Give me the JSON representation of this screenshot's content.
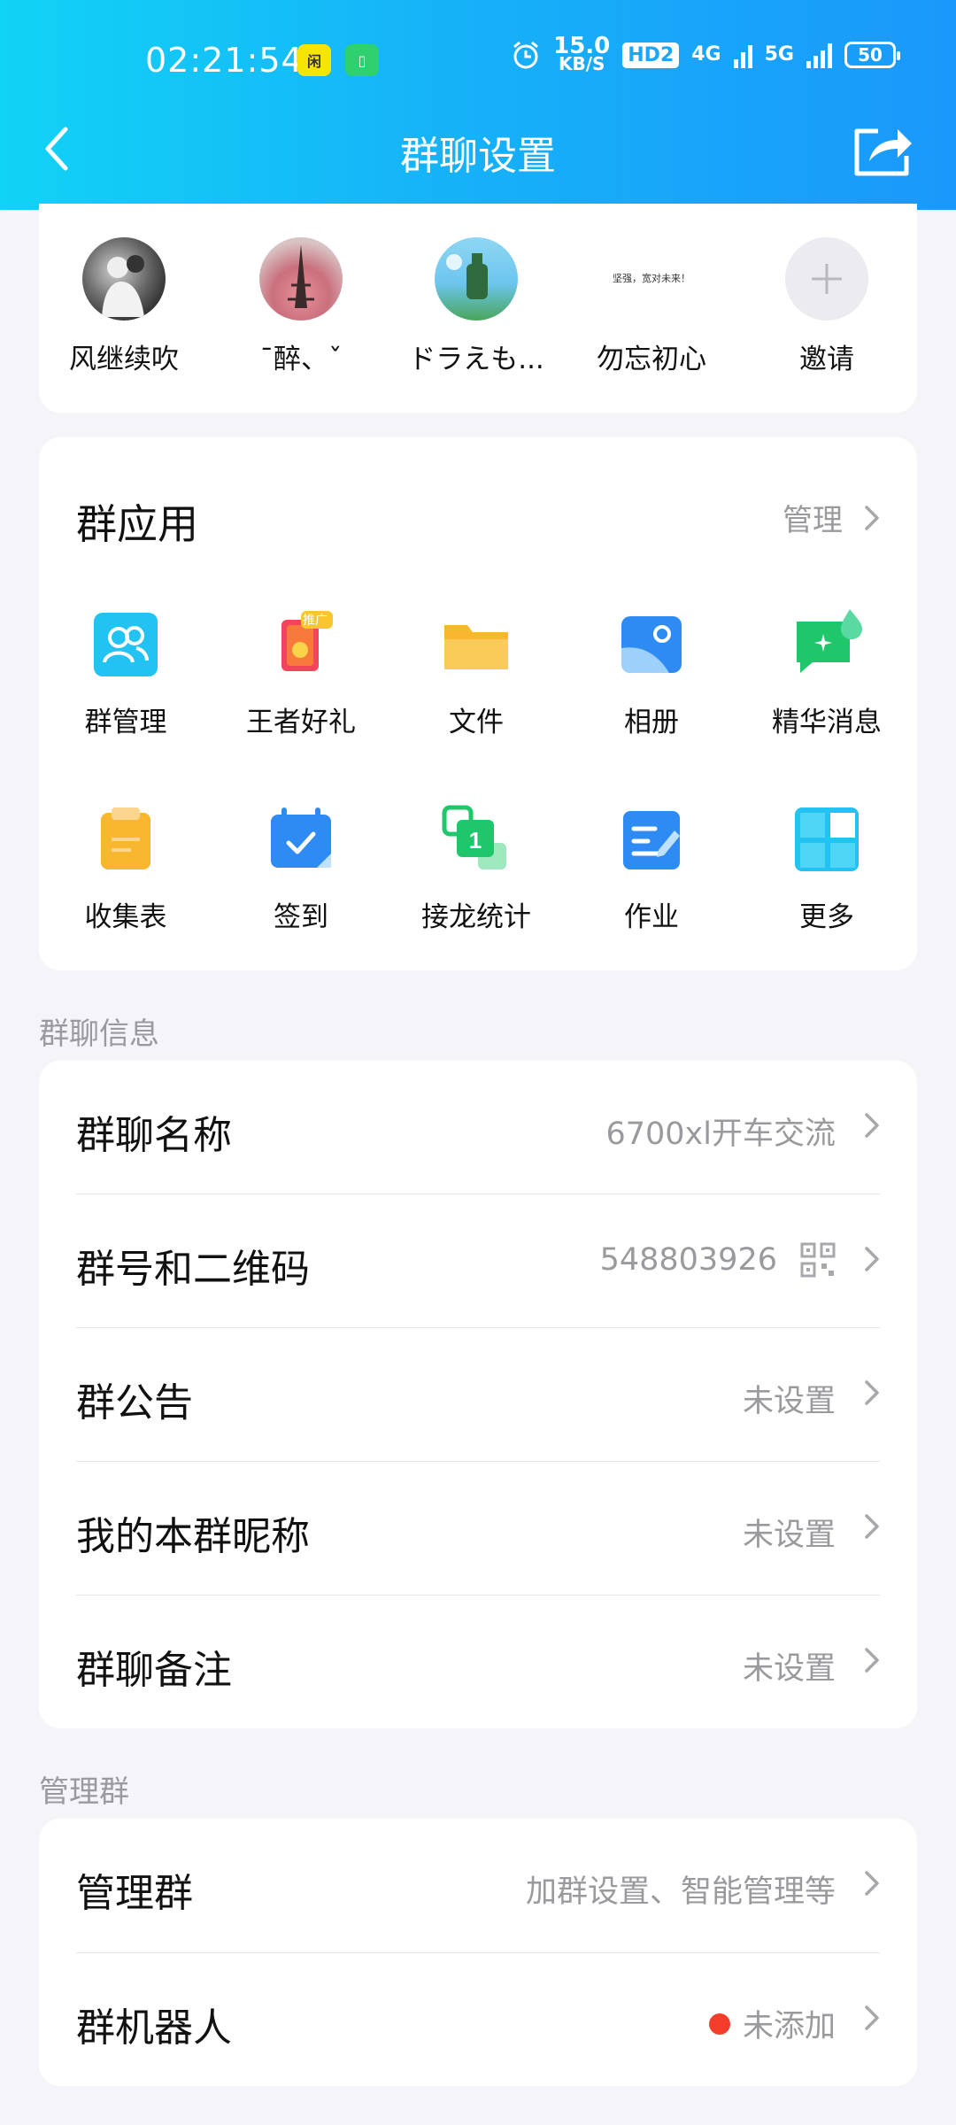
{
  "status_bar": {
    "time": "02:21:54",
    "speed_value": "15.0",
    "speed_unit": "KB/S",
    "hd": "HD2",
    "net_4g": "4G",
    "net_5g": "5G",
    "battery": "50"
  },
  "nav": {
    "title": "群聊设置",
    "back_icon": "back-arrow-icon",
    "share_icon": "share-icon"
  },
  "members": [
    {
      "name": "风继续吹"
    },
    {
      "name": "ˉ醉、ˇ"
    },
    {
      "name": "ドラえも..."
    },
    {
      "name": "勿忘初心",
      "avatar_text": "坚强，宽对未来！"
    },
    {
      "name": "邀请"
    }
  ],
  "group_apps": {
    "title": "群应用",
    "action": "管理",
    "items": [
      {
        "label": "群管理",
        "icon": "group-manage-icon",
        "color": "#22C3F2"
      },
      {
        "label": "王者好礼",
        "icon": "gift-icon",
        "badge": "推广",
        "color": "#F2445A"
      },
      {
        "label": "文件",
        "icon": "folder-icon",
        "color": "#F9B62F"
      },
      {
        "label": "相册",
        "icon": "album-icon",
        "color": "#2E8BF3"
      },
      {
        "label": "精华消息",
        "icon": "essence-message-icon",
        "color": "#1FC76A"
      },
      {
        "label": "收集表",
        "icon": "clipboard-icon",
        "color": "#F9B62F"
      },
      {
        "label": "签到",
        "icon": "calendar-check-icon",
        "color": "#2E8BF3"
      },
      {
        "label": "接龙统计",
        "icon": "relay-count-icon",
        "color": "#1FC76A"
      },
      {
        "label": "作业",
        "icon": "homework-icon",
        "color": "#2E8BF3"
      },
      {
        "label": "更多",
        "icon": "more-grid-icon",
        "color": "#22C3F2"
      }
    ]
  },
  "group_info": {
    "section_label": "群聊信息",
    "rows": [
      {
        "label": "群聊名称",
        "value": "6700xl开车交流"
      },
      {
        "label": "群号和二维码",
        "value": "548803926"
      },
      {
        "label": "群公告",
        "value": "未设置"
      },
      {
        "label": "我的本群昵称",
        "value": "未设置"
      },
      {
        "label": "群聊备注",
        "value": "未设置"
      }
    ]
  },
  "manage_group": {
    "section_label": "管理群",
    "rows": [
      {
        "label": "管理群",
        "value": "加群设置、智能管理等"
      },
      {
        "label": "群机器人",
        "value": "未添加"
      }
    ]
  },
  "colors": {
    "accent_start": "#11D3F5",
    "accent_end": "#1A98FB",
    "muted": "#9A9A9E",
    "red_dot": "#F43E2B"
  }
}
